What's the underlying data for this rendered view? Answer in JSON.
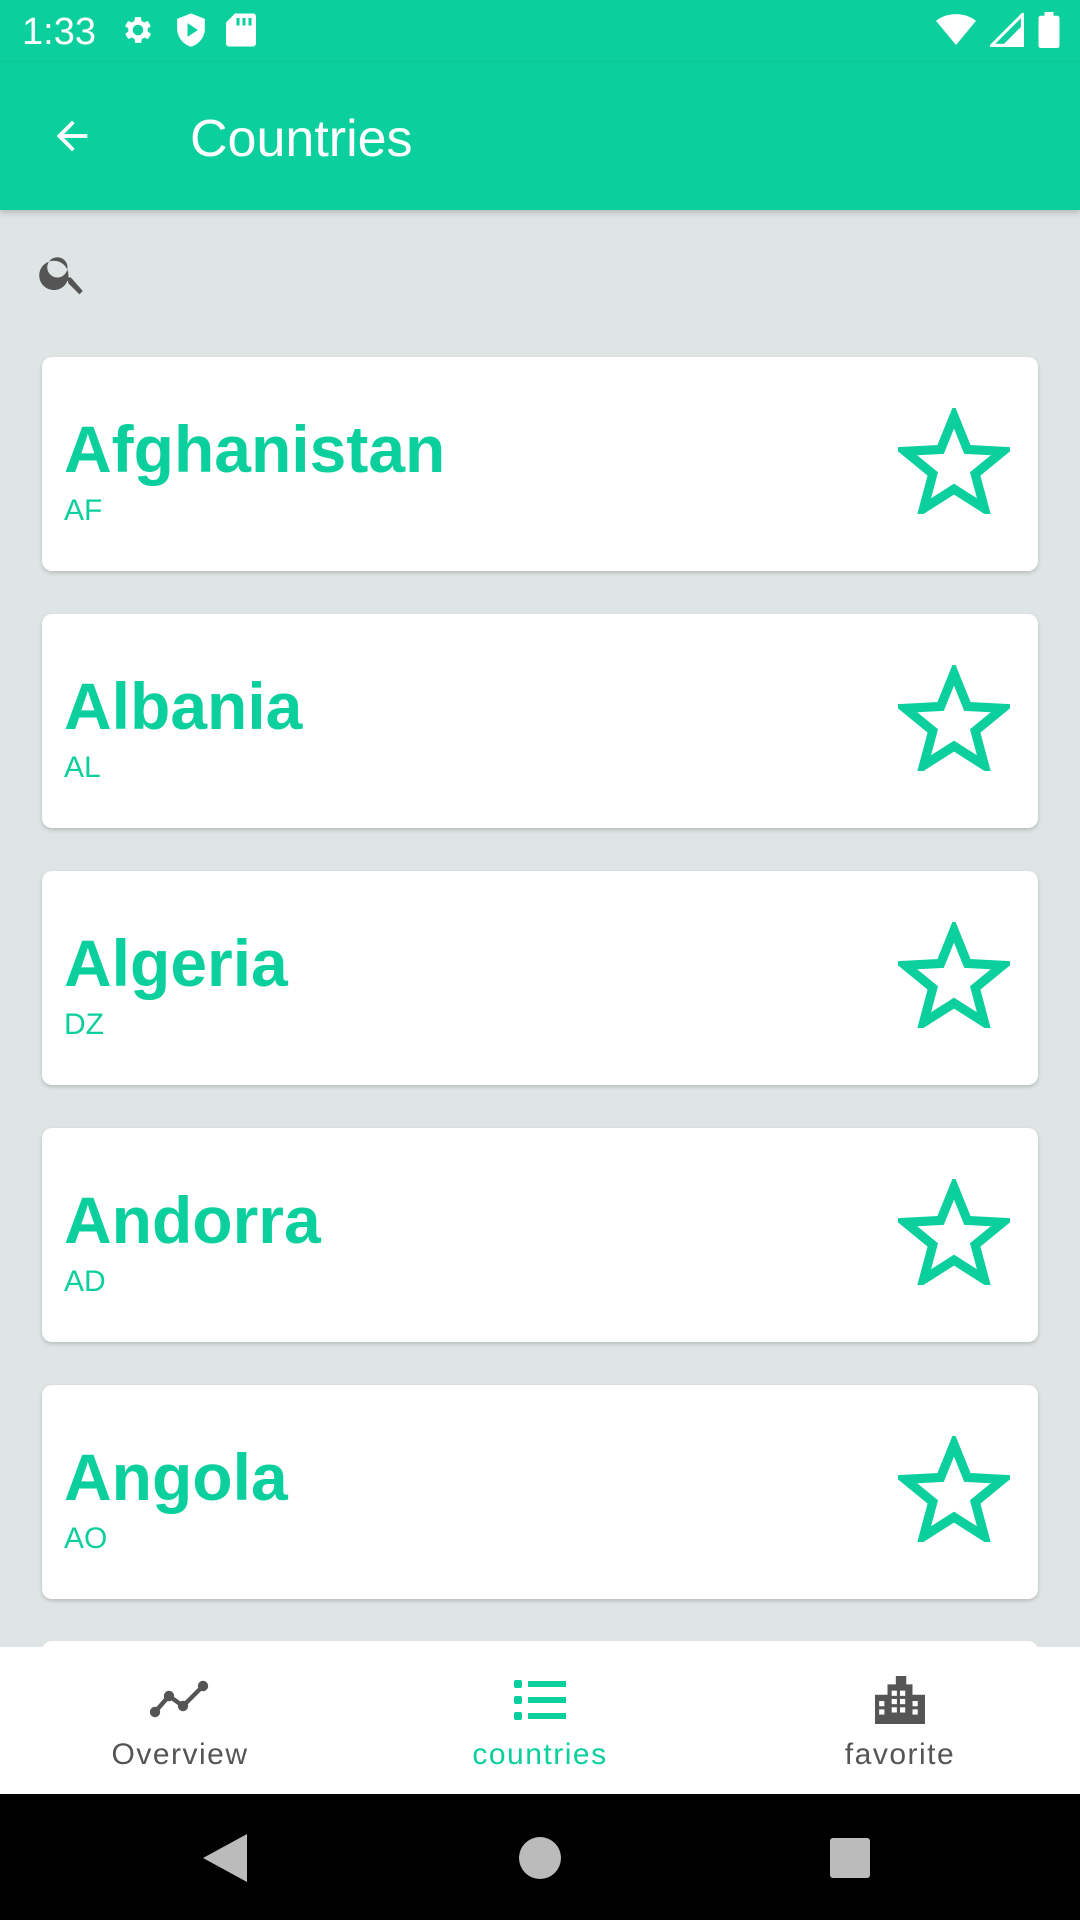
{
  "status_bar": {
    "time": "1:33",
    "background": "#0bcf9c",
    "left_icons": [
      "gear-icon",
      "shield-play-icon",
      "sd-card-icon"
    ],
    "right_icons": [
      "wifi-icon",
      "cell-signal-icon",
      "battery-icon"
    ]
  },
  "app_bar": {
    "title": "Countries",
    "back_icon": "arrow-back-icon"
  },
  "search": {
    "icon": "search-icon"
  },
  "countries": [
    {
      "name": "Afghanistan",
      "code": "AF"
    },
    {
      "name": "Albania",
      "code": "AL"
    },
    {
      "name": "Algeria",
      "code": "DZ"
    },
    {
      "name": "Andorra",
      "code": "AD"
    },
    {
      "name": "Angola",
      "code": "AO"
    }
  ],
  "bottom_nav": {
    "items": [
      {
        "label": "Overview",
        "icon": "trending-line-icon",
        "active": false
      },
      {
        "label": "countries",
        "icon": "list-icon",
        "active": true
      },
      {
        "label": "favorite",
        "icon": "building-icon",
        "active": false
      }
    ]
  },
  "colors": {
    "accent": "#0bcf9c",
    "background": "#dfe5e5",
    "inactive": "#555555"
  }
}
